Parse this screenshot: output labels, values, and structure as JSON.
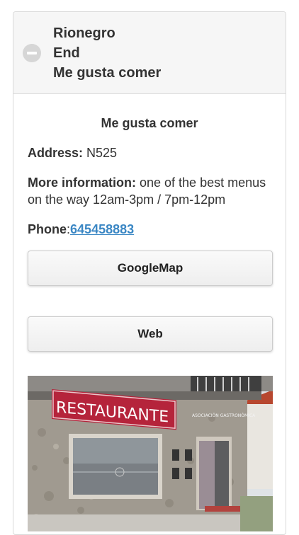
{
  "header": {
    "lines": [
      "Rionegro",
      "End",
      "Me gusta comer"
    ]
  },
  "place": {
    "title": "Me gusta comer",
    "address_label": "Address:",
    "address_value": " N525",
    "info_label": "More information:",
    "info_value": " one of the best menus on the way 12am-3pm / 7pm-12pm",
    "phone_label": "Phone",
    "phone_sep": ":",
    "phone_value": "645458883"
  },
  "buttons": {
    "map_label": "GoogleMap",
    "web_label": "Web"
  },
  "photo": {
    "sign_text": "RESTAURANTE",
    "plaque_text": "ASOCIACIÓN GASTRONÓMICA"
  },
  "colors": {
    "link": "#3b87c4",
    "header_bg": "#f6f6f6",
    "sign_red": "#b5243b"
  }
}
